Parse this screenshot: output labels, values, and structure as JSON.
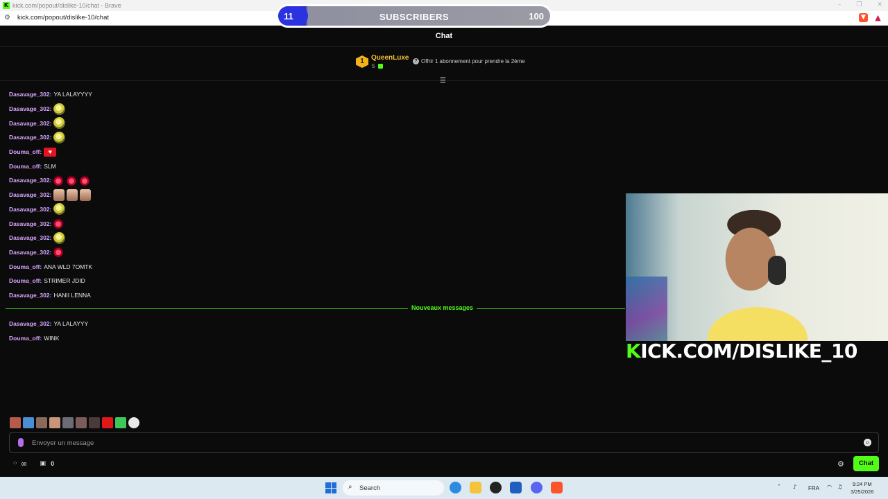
{
  "browser": {
    "window_title": "kick.com/popout/dislike-10/chat - Brave",
    "url": "kick.com/popout/dislike-10/chat"
  },
  "goal": {
    "current": "11",
    "label": "SUBSCRIBERS",
    "target": "100",
    "progress": 0.11
  },
  "chat": {
    "title": "Chat",
    "leaderboard": {
      "rank": "1",
      "name": "QueenLuxe",
      "count": "5",
      "offer_text": "Offrir 1 abonnement pour prendre la 2ème"
    },
    "messages": [
      {
        "user": "Dasavage_302",
        "text": "YA LALAYYYY",
        "emotes": []
      },
      {
        "user": "Dasavage_302",
        "text": "",
        "emotes": [
          "smile"
        ]
      },
      {
        "user": "Dasavage_302",
        "text": "",
        "emotes": [
          "smile"
        ]
      },
      {
        "user": "Dasavage_302",
        "text": "",
        "emotes": [
          "smile"
        ]
      },
      {
        "user": "Douma_off",
        "text": "",
        "emotes": [
          "red"
        ]
      },
      {
        "user": "Douma_off",
        "text": "SLM",
        "emotes": []
      },
      {
        "user": "Dasavage_302",
        "text": "",
        "emotes": [
          "fire",
          "fire",
          "fire"
        ]
      },
      {
        "user": "Dasavage_302",
        "text": "",
        "emotes": [
          "face",
          "face",
          "face"
        ]
      },
      {
        "user": "Dasavage_302",
        "text": "",
        "emotes": [
          "smile"
        ]
      },
      {
        "user": "Dasavage_302",
        "text": "",
        "emotes": [
          "fire"
        ]
      },
      {
        "user": "Dasavage_302",
        "text": "",
        "emotes": [
          "smile"
        ]
      },
      {
        "user": "Dasavage_302",
        "text": "",
        "emotes": [
          "fire"
        ]
      },
      {
        "user": "Douma_off",
        "text": "ANA WLD 7OMTK",
        "emotes": []
      },
      {
        "user": "Douma_off",
        "text": "STRIMER JDID",
        "emotes": []
      },
      {
        "user": "Dasavage_302",
        "text": "HANII LENNA",
        "emotes": []
      }
    ],
    "new_messages_label": "Nouveaux messages",
    "new_messages": [
      {
        "user": "Dasavage_302",
        "text": "YA LALAYYY",
        "emotes": []
      },
      {
        "user": "Douma_off",
        "text": "WINK",
        "emotes": []
      }
    ],
    "user_colors": {
      "Dasavage_302": "#d9a6ff",
      "Douma_off": "#d9a6ff"
    },
    "input_placeholder": "Envoyer un message",
    "points_count": "0",
    "send_label": "Chat"
  },
  "stream_overlay": {
    "banner_k": "K",
    "banner_rest": "ICK.COM/DISLIKE_10"
  },
  "taskbar": {
    "search_label": "Search",
    "language": "FRA",
    "time": "9:24 PM",
    "date": "3/25/2026"
  },
  "colors": {
    "accent": "#53fc18",
    "goal_fill": "#2b33e0",
    "leader_gold": "#f3c233"
  }
}
